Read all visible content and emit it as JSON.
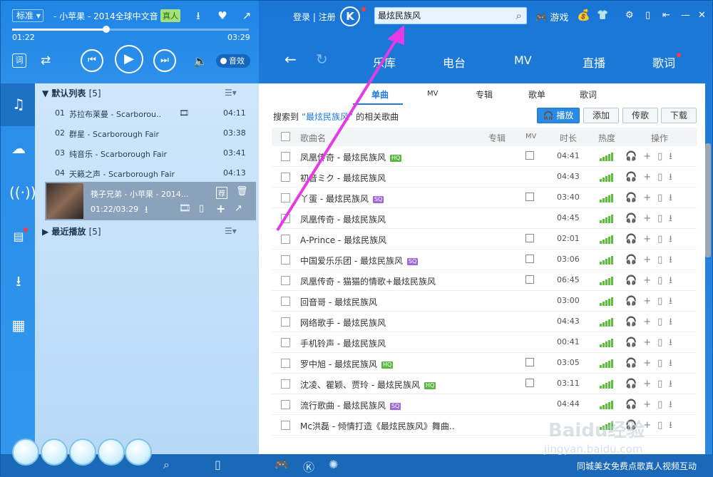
{
  "player": {
    "quality": "标准",
    "now_playing": "- 小苹果 - 2014全球中文音",
    "badge": "真人",
    "time_elapsed": "01:22",
    "time_total": "03:29",
    "progress_fraction": 0.39,
    "word_button": "词",
    "effect_label": "音效"
  },
  "topbar": {
    "login": "登录",
    "register": "注册",
    "logo_letter": "K",
    "search_value": "最炫民族风",
    "games": "游戏"
  },
  "nav": {
    "tabs": [
      "乐库",
      "电台",
      "MV",
      "直播",
      "歌词"
    ]
  },
  "playlist": {
    "default_title": "默认列表",
    "default_count": "[5]",
    "tracks": [
      {
        "no": "01",
        "title": "苏拉布莱曼 - Scarborou..",
        "time": "04:11"
      },
      {
        "no": "02",
        "title": "群星 - Scarborough Fair",
        "time": "03:38"
      },
      {
        "no": "03",
        "title": "纯音乐 - Scarborough Fair",
        "time": "03:41"
      },
      {
        "no": "04",
        "title": "天籁之声 - Scarborough Fair",
        "time": "04:13"
      }
    ],
    "current": {
      "title": "筷子兄弟 - 小苹果 - 2014...",
      "time": "01:22/03:29",
      "badge": "荐"
    },
    "recent_title": "最近播放",
    "recent_count": "[5]"
  },
  "main": {
    "subtabs": [
      "单曲",
      "MV",
      "专辑",
      "歌单",
      "歌词"
    ],
    "summary_prefix": "搜索到",
    "summary_keyword": "“最炫民族风”",
    "summary_suffix": "的相关歌曲",
    "buttons": {
      "play": "播放",
      "add": "添加",
      "share": "传歌",
      "download": "下载"
    },
    "columns": {
      "name": "歌曲名",
      "album": "专辑",
      "mv": "MV",
      "duration": "时长",
      "popularity": "热度",
      "ops": "操作"
    },
    "rows": [
      {
        "name": "凤凰传奇 - 最炫民族风",
        "tag": "HQ",
        "mv": true,
        "dur": "04:41"
      },
      {
        "name": "初音ミク - 最炫民族风",
        "tag": "",
        "mv": false,
        "dur": "04:43"
      },
      {
        "name": "丫蛋 - 最炫民族风",
        "tag": "SQ",
        "mv": true,
        "dur": "03:40"
      },
      {
        "name": "凤凰传奇 - 最炫民族风",
        "tag": "",
        "mv": false,
        "dur": "04:45"
      },
      {
        "name": "A-Prince - 最炫民族风",
        "tag": "",
        "mv": true,
        "dur": "02:01"
      },
      {
        "name": "中国爱乐乐团 - 最炫民族风",
        "tag": "SQ",
        "mv": true,
        "dur": "03:06"
      },
      {
        "name": "凤凰传奇 - 猫猫的情歌+最炫民族风",
        "tag": "",
        "mv": true,
        "dur": "06:45"
      },
      {
        "name": "回音哥 - 最炫民族风",
        "tag": "",
        "mv": false,
        "dur": "03:00"
      },
      {
        "name": "网络歌手 - 最炫民族风",
        "tag": "",
        "mv": false,
        "dur": "04:43"
      },
      {
        "name": "手机铃声 - 最炫民族风",
        "tag": "",
        "mv": false,
        "dur": "00:41"
      },
      {
        "name": "罗中旭 - 最炫民族风",
        "tag": "HQ",
        "mv": true,
        "dur": "03:05"
      },
      {
        "name": "沈凌、瞿颖、贾玲 - 最炫民族风",
        "tag": "HQ",
        "mv": true,
        "dur": "03:11"
      },
      {
        "name": "流行歌曲 - 最炫民族风",
        "tag": "SQ",
        "mv": false,
        "dur": "04:44"
      },
      {
        "name": "Mc洪磊 - 倾情打造《最炫民族风》舞曲..",
        "tag": "",
        "mv": false,
        "dur": ""
      }
    ]
  },
  "bottom": {
    "ad": "同城美女免费点歌真人视频互动",
    "watermark": "Baidu经验",
    "watermark_sub": "jingyan.baidu.com"
  },
  "colors": {
    "accent": "#2a8be6",
    "hq": "#57b840",
    "sq": "#9d6bd6",
    "arrow": "#e53be6"
  }
}
